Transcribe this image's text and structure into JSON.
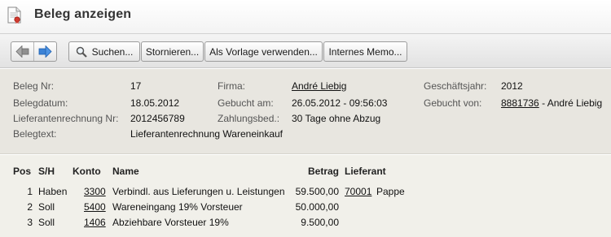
{
  "header": {
    "title": "Beleg anzeigen",
    "icon": "document-icon"
  },
  "toolbar": {
    "back_icon": "arrow-left-icon",
    "forward_icon": "arrow-right-icon",
    "search_label": "Suchen...",
    "cancel_label": "Stornieren...",
    "template_label": "Als Vorlage verwenden...",
    "memo_label": "Internes Memo..."
  },
  "info": {
    "beleg_nr": {
      "label": "Beleg Nr:",
      "value": "17"
    },
    "belegdatum": {
      "label": "Belegdatum:",
      "value": "18.05.2012"
    },
    "lieferantenrechnung_nr": {
      "label": "Lieferantenrechnung Nr:",
      "value": "2012456789"
    },
    "belegtext": {
      "label": "Belegtext:",
      "value": "Lieferantenrechnung Wareneinkauf"
    },
    "firma": {
      "label": "Firma:",
      "value": "André Liebig"
    },
    "gebucht_am": {
      "label": "Gebucht am:",
      "value": "26.05.2012 - 09:56:03"
    },
    "zahlungsbed": {
      "label": "Zahlungsbed.:",
      "value": "30 Tage ohne Abzug"
    },
    "geschaeftsjahr": {
      "label": "Geschäftsjahr:",
      "value": "2012"
    },
    "gebucht_von": {
      "label": "Gebucht von:",
      "user_id": "8881736",
      "user_name": "- André Liebig"
    }
  },
  "postings": {
    "headers": {
      "pos": "Pos",
      "sh": "S/H",
      "konto": "Konto",
      "name": "Name",
      "betrag": "Betrag",
      "lieferant": "Lieferant"
    },
    "rows": [
      {
        "pos": "1",
        "sh": "Haben",
        "konto": "3300",
        "name": "Verbindl. aus Lieferungen u. Leistungen",
        "betrag": "59.500,00",
        "lieferant_nr": "70001",
        "lieferant_name": "Pappe"
      },
      {
        "pos": "2",
        "sh": "Soll",
        "konto": "5400",
        "name": "Wareneingang 19% Vorsteuer",
        "betrag": "50.000,00",
        "lieferant_nr": "",
        "lieferant_name": ""
      },
      {
        "pos": "3",
        "sh": "Soll",
        "konto": "1406",
        "name": "Abziehbare Vorsteuer 19%",
        "betrag": "9.500,00",
        "lieferant_nr": "",
        "lieferant_name": ""
      }
    ]
  }
}
